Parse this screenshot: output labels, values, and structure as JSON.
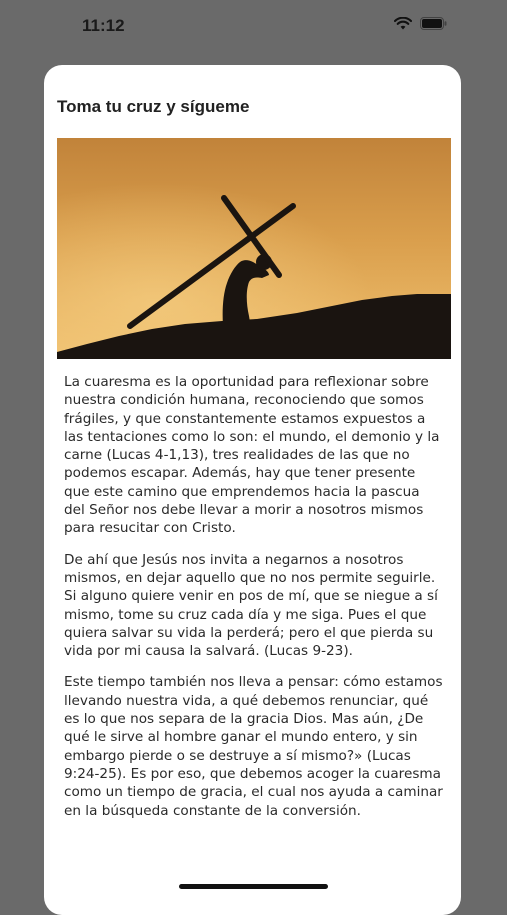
{
  "status_bar": {
    "time": "11:12"
  },
  "article": {
    "title": "Toma tu cruz y sígueme",
    "image_icon": "cross-silhouette-image",
    "paragraphs": [
      "La cuaresma es la oportunidad para reflexionar sobre nuestra condición humana, reconociendo que somos frágiles, y que constantemente estamos expuestos a las tentaciones como lo son: el mundo, el demonio y la carne (Lucas 4-1,13), tres realidades de las que no podemos escapar. Además, hay que tener presente que este camino que emprendemos hacia la pascua del Señor nos debe llevar a morir a nosotros mismos para resucitar con Cristo.",
      "De ahí que Jesús nos invita a negarnos a nosotros mismos, en dejar aquello que no nos permite seguirle. Si alguno quiere venir en pos de mí, que se niegue a sí mismo, tome su cruz cada día y me siga. Pues el que quiera salvar su vida la perderá; pero el que pierda su vida por mi causa la salvará. (Lucas 9-23).",
      "Este tiempo también nos lleva a pensar: cómo estamos llevando nuestra vida, a qué debemos renunciar, qué es lo que nos separa de la gracia Dios. Mas aún, ¿De qué le sirve al hombre ganar el mundo entero, y sin embargo pierde o se destruye a sí mismo?» (Lucas 9:24-25). Es por eso, que debemos acoger la cuaresma como un tiempo de gracia, el cual nos ayuda a caminar en la búsqueda constante de la conversión."
    ]
  }
}
